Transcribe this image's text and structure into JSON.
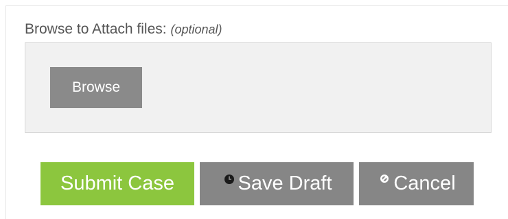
{
  "attach": {
    "label": "Browse to Attach files:",
    "optional": "(optional)",
    "browse_label": "Browse"
  },
  "actions": {
    "submit_label": "Submit Case",
    "draft_label": "Save Draft",
    "draft_icon": "clock-icon",
    "cancel_label": "Cancel",
    "cancel_icon": "ban-icon"
  },
  "colors": {
    "submit": "#8cc63e",
    "secondary": "#868686",
    "browse": "#8a8a8a",
    "drop_zone": "#f1f1f1"
  }
}
